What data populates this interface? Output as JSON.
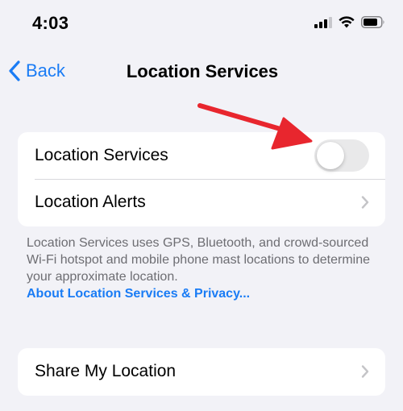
{
  "status_bar": {
    "time": "4:03",
    "icons": [
      "cellular-signal-icon",
      "wifi-icon",
      "battery-icon"
    ]
  },
  "nav": {
    "back_label": "Back",
    "title": "Location Services"
  },
  "settings_group_1": {
    "rows": [
      {
        "label": "Location Services",
        "control": "toggle",
        "toggle_on": false
      },
      {
        "label": "Location Alerts",
        "control": "chevron"
      }
    ]
  },
  "footer": {
    "description": "Location Services uses GPS, Bluetooth, and crowd-sourced Wi-Fi hotspot and mobile phone mast locations to determine your approximate location.",
    "link": "About Location Services & Privacy..."
  },
  "settings_group_2": {
    "rows": [
      {
        "label": "Share My Location",
        "control": "chevron"
      }
    ]
  },
  "colors": {
    "accent": "#1a7cf5",
    "background": "#f2f2f7",
    "annotation_arrow": "#e8262e"
  }
}
